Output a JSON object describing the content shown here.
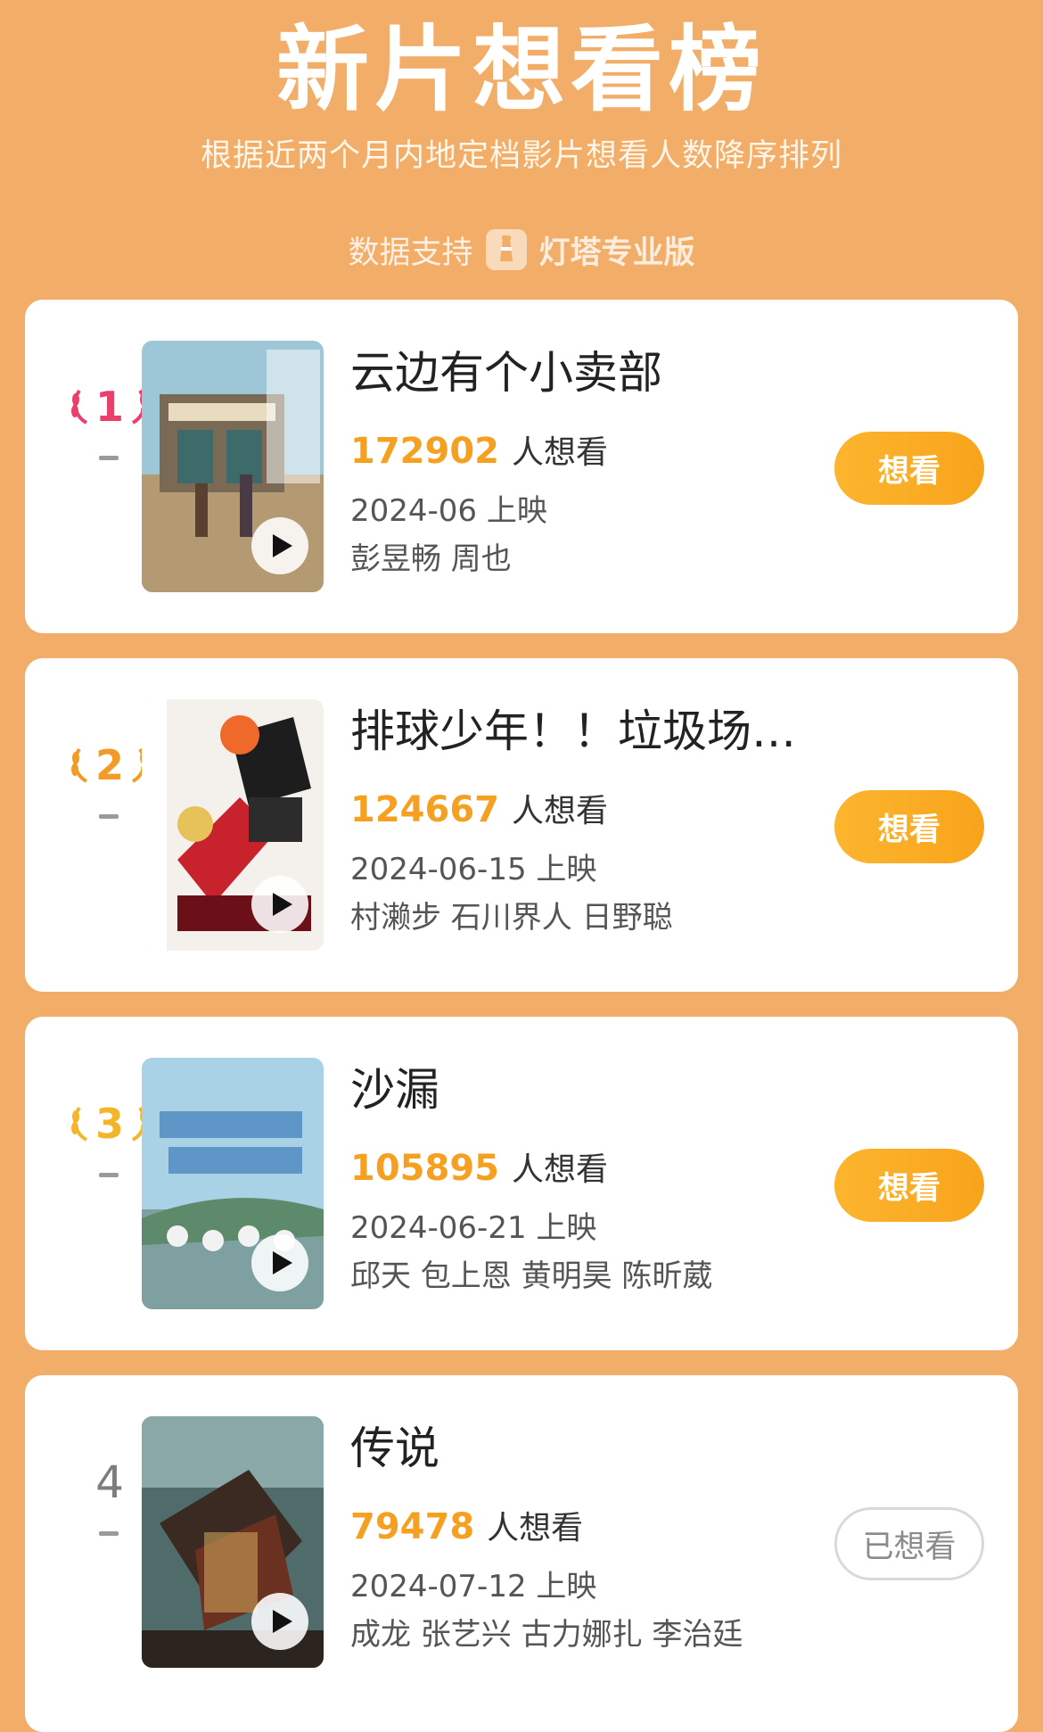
{
  "header": {
    "title": "新片想看榜",
    "subtitle": "根据近两个月内地定档影片想看人数降序排列",
    "source_prefix": "数据支持",
    "source_brand": "灯塔专业版"
  },
  "movies": [
    {
      "rank": "1",
      "title": "云边有个小卖部",
      "want_count": "172902",
      "want_label": "人想看",
      "release": "2024-06 上映",
      "cast": "彭昱畅 周也",
      "button": "想看",
      "rank_color": "#ea3f6b"
    },
    {
      "rank": "2",
      "title": "排球少年！！垃圾场…",
      "want_count": "124667",
      "want_label": "人想看",
      "release": "2024-06-15 上映",
      "cast": "村濑步 石川界人 日野聪",
      "button": "想看",
      "rank_color": "#f39b26"
    },
    {
      "rank": "3",
      "title": "沙漏",
      "want_count": "105895",
      "want_label": "人想看",
      "release": "2024-06-21 上映",
      "cast": "邱天 包上恩 黄明昊 陈昕葳",
      "button": "想看",
      "rank_color": "#f4b52a"
    },
    {
      "rank": "4",
      "title": "传说",
      "want_count": "79478",
      "want_label": "人想看",
      "release": "2024-07-12 上映",
      "cast": "成龙 张艺兴 古力娜扎 李治廷",
      "button": "已想看",
      "rank_color": "#7d7d7d"
    }
  ]
}
